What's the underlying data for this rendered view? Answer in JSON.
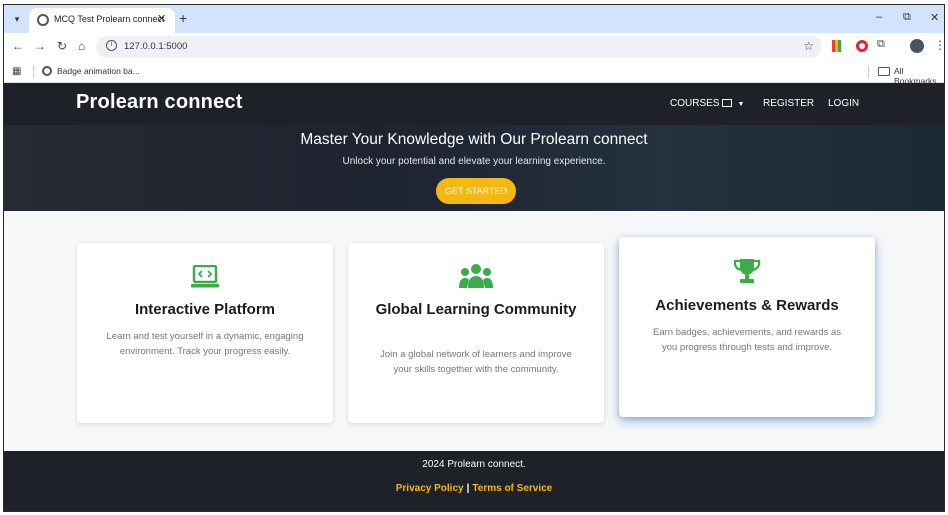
{
  "browser": {
    "tab_title": "MCQ Test Prolearn connect",
    "tab_close": "✕",
    "new_tab": "+",
    "window": {
      "minimize": "–",
      "restore": "⧉",
      "close": "✕"
    },
    "url": "127.0.0.1:5000",
    "bookmark_item": "Badge animation ba...",
    "all_bookmarks": "All Bookmarks"
  },
  "header": {
    "brand": "Prolearn connect",
    "nav": {
      "courses": "COURSES",
      "register": "REGISTER",
      "login": "LOGIN"
    }
  },
  "hero": {
    "title": "Master Your Knowledge with Our Prolearn connect",
    "subtitle": "Unlock your potential and elevate your learning experience.",
    "cta": "GET STARTED"
  },
  "features": [
    {
      "icon": "laptop-code-icon",
      "title": "Interactive Platform",
      "text": "Learn and test yourself in a dynamic, engaging environment. Track your progress easily."
    },
    {
      "icon": "users-icon",
      "title": "Global Learning Community",
      "text": "Join a global network of learners and improve your skills together with the community."
    },
    {
      "icon": "trophy-icon",
      "title": "Achievements & Rewards",
      "text": "Earn badges, achievements, and rewards as you progress through tests and improve."
    }
  ],
  "footer": {
    "copyright": "2024 Prolearn connect.",
    "privacy": "Privacy Policy",
    "separator": "|",
    "terms": "Terms of Service"
  },
  "colors": {
    "accent": "#f5b811",
    "dark": "#1e2128",
    "icon_green": "#3daa4b"
  }
}
